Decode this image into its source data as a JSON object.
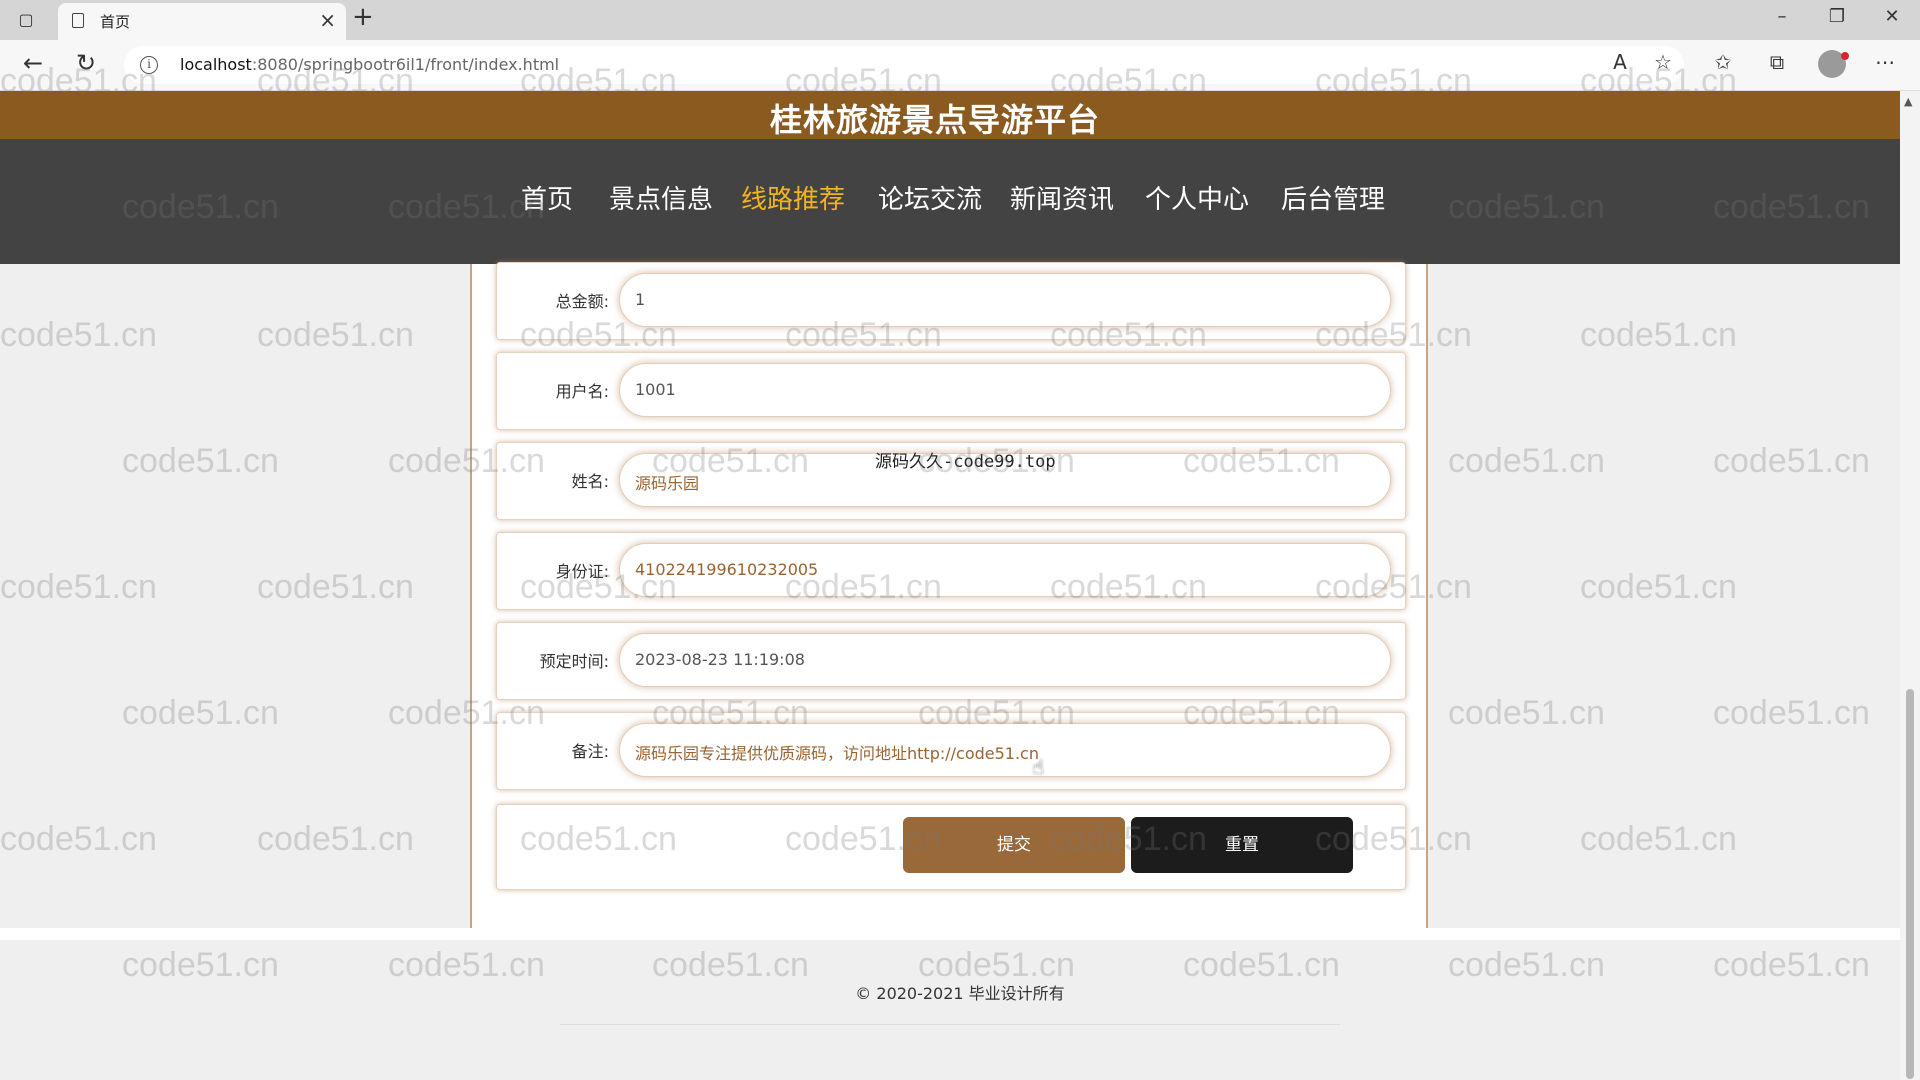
{
  "browser": {
    "tab_title": "首页",
    "url_host": "localhost",
    "url_path": ":8080/springbootr6il1/front/index.html"
  },
  "site": {
    "title": "桂林旅游景点导游平台",
    "nav": [
      {
        "label": "首页",
        "active": false
      },
      {
        "label": "景点信息",
        "active": false
      },
      {
        "label": "线路推荐",
        "active": true
      },
      {
        "label": "论坛交流",
        "active": false
      },
      {
        "label": "新闻资讯",
        "active": false
      },
      {
        "label": "个人中心",
        "active": false
      },
      {
        "label": "后台管理",
        "active": false
      }
    ]
  },
  "form": {
    "fields": [
      {
        "label": "总金额:",
        "value": "1"
      },
      {
        "label": "用户名:",
        "value": "1001"
      },
      {
        "label": "姓名:",
        "value": "源码乐园"
      },
      {
        "label": "身份证:",
        "value": "410224199610232005"
      },
      {
        "label": "预定时间:",
        "value": "2023-08-23 11:19:08"
      },
      {
        "label": "备注:",
        "value": "源码乐园专注提供优质源码，访问地址http://code51.cn"
      }
    ],
    "submit_label": "提交",
    "reset_label": "重置"
  },
  "overlay_text": "源码久久-code99.top",
  "footer": {
    "copyright": "© 2020-2021 毕业设计所有"
  },
  "watermark_text": "code51.cn",
  "colors": {
    "title_bar": "#8b5a1e",
    "nav_bar": "#434343",
    "nav_active": "#f0b420",
    "submit_button": "#9a693a",
    "reset_button": "#1c1c1c"
  }
}
